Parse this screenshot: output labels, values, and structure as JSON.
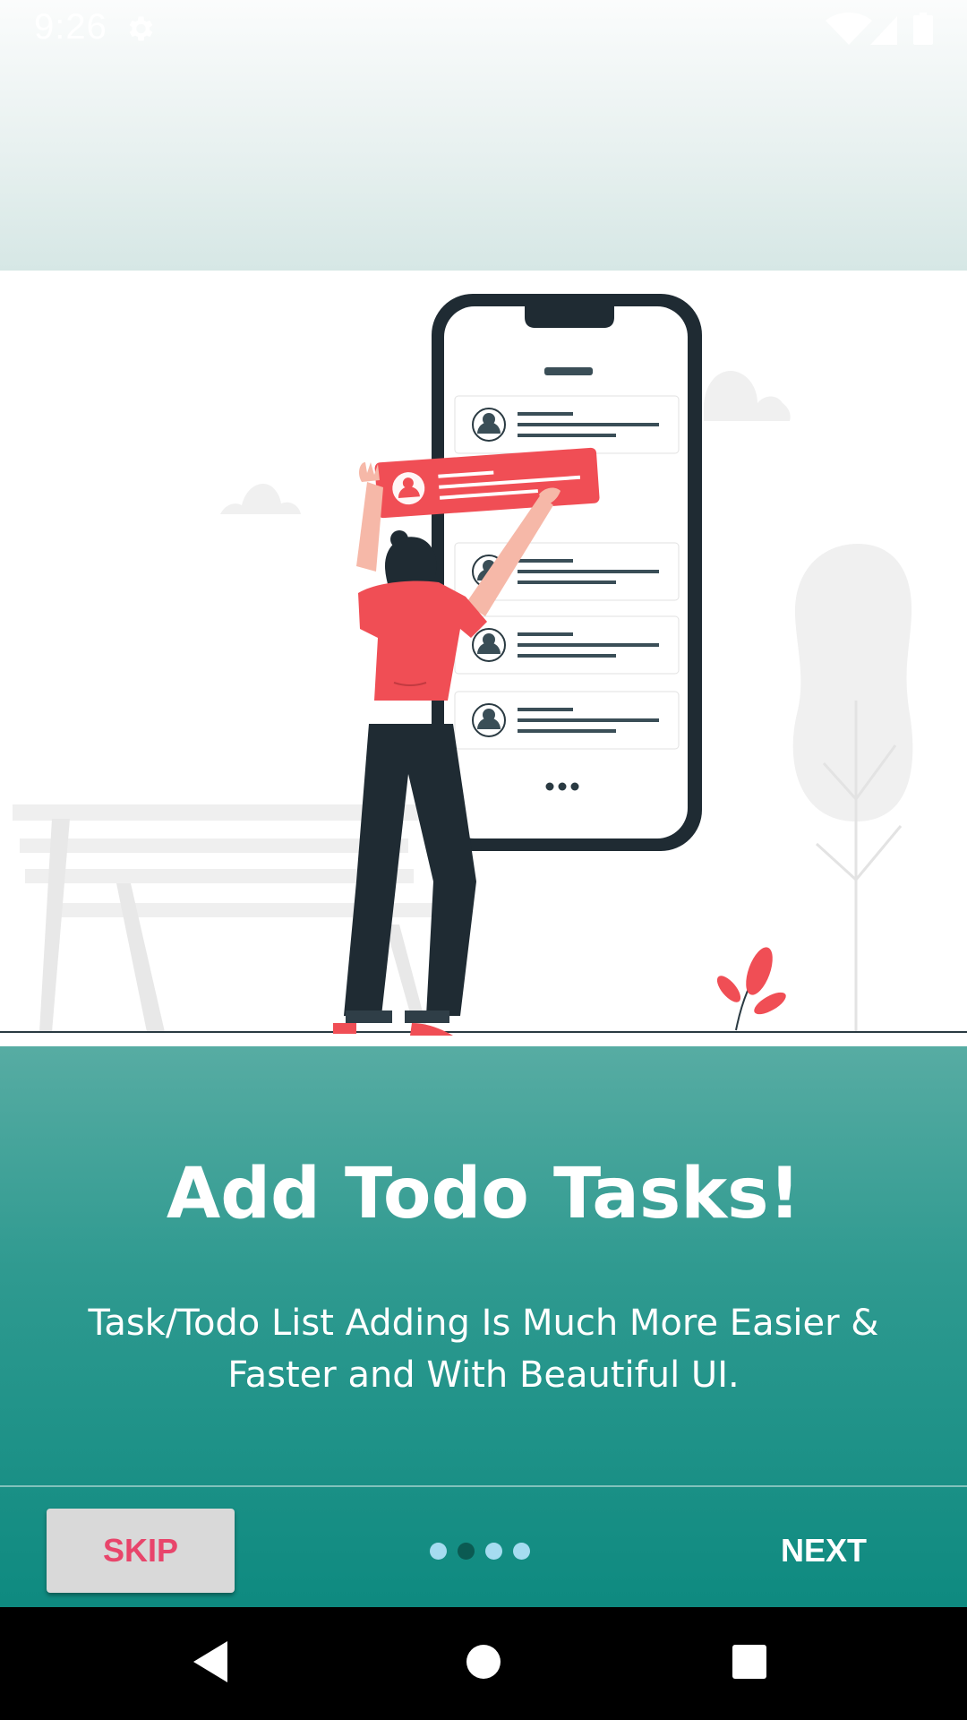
{
  "status_bar": {
    "time": "9:26",
    "icons": [
      "settings-gear-icon",
      "wifi-icon",
      "cell-signal-icon",
      "battery-icon"
    ]
  },
  "illustration": {
    "icon": "person-adding-todo-to-phone-illustration"
  },
  "onboarding": {
    "title": "Add Todo Tasks!",
    "description": "Task/Todo List Adding Is Much More Easier & Faster and With Beautiful UI.",
    "current_page": 2,
    "total_pages": 4
  },
  "footer": {
    "skip_label": "SKIP",
    "next_label": "NEXT"
  },
  "nav_bar": {
    "icons": [
      "back-icon",
      "home-icon",
      "recents-icon"
    ]
  },
  "colors": {
    "accent_teal": "#14897f",
    "skip_text": "#e8456b",
    "illustration_red": "#f04e55",
    "illustration_dark": "#1f2b33",
    "dot_active": "#0b5a52",
    "dot_inactive": "#a5dcf0"
  }
}
